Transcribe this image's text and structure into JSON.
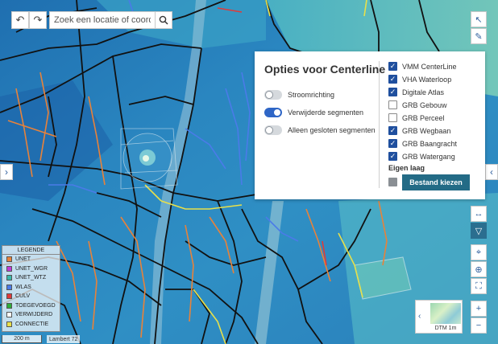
{
  "toolbar": {
    "undo_icon": "undo-icon",
    "redo_icon": "redo-icon",
    "search_placeholder": "Zoek een locatie of coordinaten",
    "search_icon": "search-icon"
  },
  "panel": {
    "title": "Opties voor Centerline",
    "toggles": [
      {
        "label": "Stroomrichting",
        "on": false
      },
      {
        "label": "Verwijderde segmenten",
        "on": true
      },
      {
        "label": "Alleen gesloten segmenten",
        "on": false
      }
    ],
    "layers": [
      {
        "label": "VMM CenterLine",
        "checked": true
      },
      {
        "label": "VHA Waterloop",
        "checked": true
      },
      {
        "label": "Digitale Atlas",
        "checked": true
      },
      {
        "label": "GRB Gebouw",
        "checked": false
      },
      {
        "label": "GRB Perceel",
        "checked": false
      },
      {
        "label": "GRB Wegbaan",
        "checked": true
      },
      {
        "label": "GRB Baangracht",
        "checked": true
      },
      {
        "label": "GRB Watergang",
        "checked": true
      }
    ],
    "own_layer_label": "Eigen laag",
    "choose_file_label": "Bestand kiezen"
  },
  "legend": {
    "title": "LEGENDE",
    "items": [
      {
        "label": "UNET",
        "color": "#e8823a"
      },
      {
        "label": "UNET_WGR",
        "color": "#c23ad6"
      },
      {
        "label": "UNET_WTZ",
        "color": "#3ab8a8"
      },
      {
        "label": "WLAS",
        "color": "#4a7be8"
      },
      {
        "label": "CULV",
        "color": "#e03a3a"
      },
      {
        "label": "TOEGEVOEGD",
        "color": "#2fae3a"
      },
      {
        "label": "VERWIJDERD",
        "color": "#ffffff"
      },
      {
        "label": "CONNECTIE",
        "color": "#e8e04a"
      }
    ]
  },
  "scale": {
    "distance": "200 m",
    "crs": "Lambert 72"
  },
  "basemap": {
    "label": "DTM 1m"
  },
  "right_tools": {
    "icons": [
      "cursor-icon",
      "pencil-icon",
      "expand-icon",
      "measure-icon",
      "filter-icon",
      "location-icon",
      "globe-icon",
      "fullscreen-icon",
      "zoom-in-icon",
      "zoom-out-icon"
    ],
    "zoom_in": "+",
    "zoom_out": "−"
  },
  "colors": {
    "accent": "#236b86",
    "checkbox": "#1f4f9e",
    "toggle_on": "#2f66c6"
  }
}
